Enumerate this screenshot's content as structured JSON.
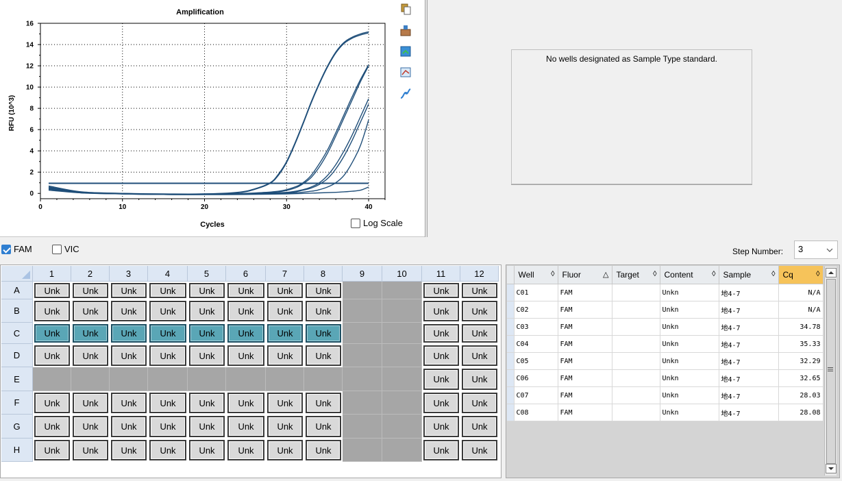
{
  "chart_data": {
    "type": "line",
    "title": "Amplification",
    "xlabel": "Cycles",
    "ylabel": "RFU (10^3)",
    "xlim": [
      0,
      42
    ],
    "ylim": [
      -0.5,
      16
    ],
    "xticks": [
      0,
      10,
      20,
      30,
      40
    ],
    "yticks": [
      0,
      2,
      4,
      6,
      8,
      10,
      12,
      14,
      16
    ],
    "grid": "dotted",
    "threshold": 0.95,
    "series": [
      {
        "x": [
          1,
          5,
          10,
          15,
          20,
          24,
          26,
          28,
          29,
          30,
          31,
          32,
          33,
          34,
          35,
          36,
          37,
          38,
          39,
          40
        ],
        "values": [
          0.3,
          0.05,
          -0.05,
          -0.08,
          -0.05,
          0.1,
          0.4,
          1.0,
          1.8,
          3.0,
          4.7,
          6.6,
          8.6,
          10.4,
          12.0,
          13.3,
          14.2,
          14.7,
          15.0,
          15.2
        ]
      },
      {
        "x": [
          1,
          5,
          10,
          15,
          20,
          24,
          26,
          28,
          29,
          30,
          31,
          32,
          33,
          34,
          35,
          36,
          37,
          38,
          39,
          40
        ],
        "values": [
          0.4,
          0.1,
          0.0,
          -0.05,
          -0.05,
          0.05,
          0.35,
          0.95,
          1.7,
          2.9,
          4.6,
          6.5,
          8.5,
          10.3,
          11.9,
          13.2,
          14.1,
          14.6,
          14.9,
          15.1
        ]
      },
      {
        "x": [
          1,
          5,
          10,
          15,
          20,
          25,
          29,
          31,
          32,
          33,
          34,
          35,
          36,
          37,
          38,
          39,
          40
        ],
        "values": [
          0.6,
          0.1,
          -0.02,
          -0.1,
          -0.08,
          0.0,
          0.2,
          0.6,
          1.0,
          1.7,
          2.8,
          4.1,
          5.7,
          7.4,
          9.1,
          10.7,
          12.1
        ]
      },
      {
        "x": [
          1,
          5,
          10,
          15,
          20,
          25,
          29,
          31,
          32,
          33,
          34,
          35,
          36,
          37,
          38,
          39,
          40
        ],
        "values": [
          0.7,
          0.15,
          0.0,
          -0.1,
          -0.1,
          -0.02,
          0.15,
          0.5,
          0.9,
          1.5,
          2.5,
          3.8,
          5.4,
          7.1,
          8.8,
          10.5,
          12.0
        ]
      },
      {
        "x": [
          1,
          5,
          10,
          15,
          20,
          25,
          30,
          32,
          33,
          34,
          35,
          36,
          37,
          38,
          39,
          40
        ],
        "values": [
          0.5,
          0.1,
          -0.02,
          -0.1,
          -0.1,
          -0.05,
          0.1,
          0.35,
          0.6,
          1.0,
          1.7,
          2.7,
          4.0,
          5.5,
          7.2,
          8.9
        ]
      },
      {
        "x": [
          1,
          5,
          10,
          15,
          20,
          25,
          30,
          32,
          33,
          34,
          35,
          36,
          37,
          38,
          39,
          40
        ],
        "values": [
          0.5,
          0.1,
          -0.02,
          -0.1,
          -0.1,
          -0.05,
          0.05,
          0.3,
          0.5,
          0.85,
          1.4,
          2.3,
          3.5,
          5.0,
          6.7,
          8.4
        ]
      },
      {
        "x": [
          1,
          5,
          10,
          15,
          20,
          25,
          30,
          33,
          34,
          35,
          36,
          37,
          38,
          39,
          40
        ],
        "values": [
          0.4,
          0.05,
          -0.05,
          -0.1,
          -0.1,
          -0.05,
          0.0,
          0.2,
          0.35,
          0.6,
          1.0,
          1.7,
          2.9,
          4.5,
          6.9
        ]
      },
      {
        "x": [
          1,
          5,
          10,
          15,
          20,
          25,
          30,
          34,
          36,
          37,
          38,
          39,
          40
        ],
        "values": [
          0.6,
          0.1,
          -0.05,
          -0.1,
          -0.12,
          -0.1,
          -0.05,
          0.05,
          0.1,
          0.15,
          0.2,
          0.3,
          0.6
        ]
      }
    ]
  },
  "log_scale_label": "Log Scale",
  "standard_message": "No wells designated as Sample Type standard.",
  "fluors": [
    {
      "label": "FAM",
      "checked": true
    },
    {
      "label": "VIC",
      "checked": false
    }
  ],
  "step_number_label": "Step Number:",
  "step_number_value": "3",
  "plate": {
    "columns": [
      "1",
      "2",
      "3",
      "4",
      "5",
      "6",
      "7",
      "8",
      "9",
      "10",
      "11",
      "12"
    ],
    "rows": [
      "A",
      "B",
      "C",
      "D",
      "E",
      "F",
      "G",
      "H"
    ],
    "well_label": "Unk",
    "layout": [
      "UUUUUUUU..UU",
      "UUUUUUUU..UU",
      "SSSSSSSS..UU",
      "UUUUUUUU..UU",
      "..........UU",
      "UUUUUUUU..UU",
      "UUUUUUUU..UU",
      "UUUUUUUU..UU"
    ]
  },
  "table": {
    "headers": [
      "Well",
      "Fluor",
      "Target",
      "Content",
      "Sample",
      "Cq"
    ],
    "sort_marks": [
      "◊",
      "△",
      "◊",
      "◊",
      "◊",
      "◊"
    ],
    "rows": [
      [
        "C01",
        "FAM",
        "",
        "Unkn",
        "地4-7",
        "N/A"
      ],
      [
        "C02",
        "FAM",
        "",
        "Unkn",
        "地4-7",
        "N/A"
      ],
      [
        "C03",
        "FAM",
        "",
        "Unkn",
        "地4-7",
        "34.78"
      ],
      [
        "C04",
        "FAM",
        "",
        "Unkn",
        "地4-7",
        "35.33"
      ],
      [
        "C05",
        "FAM",
        "",
        "Unkn",
        "地4-7",
        "32.29"
      ],
      [
        "C06",
        "FAM",
        "",
        "Unkn",
        "地4-7",
        "32.65"
      ],
      [
        "C07",
        "FAM",
        "",
        "Unkn",
        "地4-7",
        "28.03"
      ],
      [
        "C08",
        "FAM",
        "",
        "Unkn",
        "地4-7",
        "28.08"
      ]
    ]
  },
  "toolbar_icons": [
    "copy-icon",
    "export-icon",
    "save-image-icon",
    "chart-options-icon",
    "curve-fit-icon"
  ],
  "colors": {
    "curve": "#1f4e79",
    "selected_well": "#5aa6b6",
    "cq_header": "#f6c35a"
  }
}
